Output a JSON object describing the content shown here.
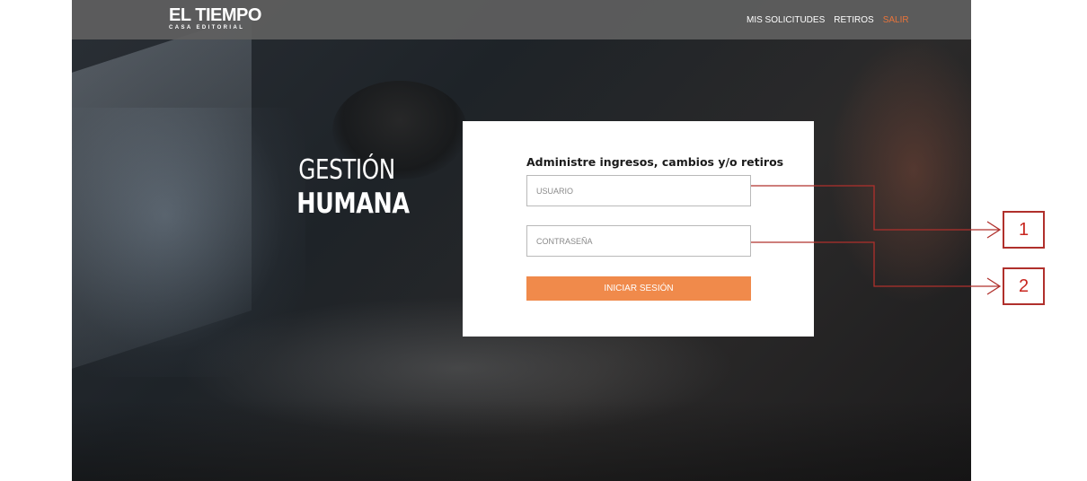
{
  "header": {
    "logo_main": "EL TIEMPO",
    "logo_sub": "CASA EDITORIAL",
    "nav": [
      {
        "label": "MIS SOLICITUDES"
      },
      {
        "label": "RETIROS"
      },
      {
        "label": "SALIR"
      }
    ]
  },
  "hero": {
    "line1": "GESTIÓN",
    "line2": "HUMANA"
  },
  "login": {
    "heading": "Administre ingresos, cambios y/o retiros",
    "username_placeholder": "USUARIO",
    "password_placeholder": "CONTRASEÑA",
    "submit_label": "INICIAR SESIÓN"
  },
  "annotations": [
    {
      "label": "1"
    },
    {
      "label": "2"
    }
  ],
  "colors": {
    "accent": "#f08a4b",
    "exit_link": "#e8743b",
    "annotation": "#b0302c"
  }
}
